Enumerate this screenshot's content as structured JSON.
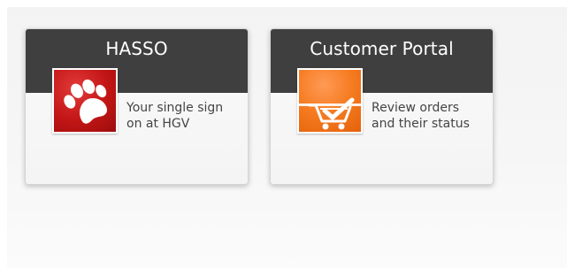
{
  "tiles": [
    {
      "title": "HASSO",
      "description_line1": "Your single sign",
      "description_line2": "on at HGV",
      "icon": "paw-icon",
      "icon_color": "#c21515"
    },
    {
      "title": "Customer Portal",
      "description_line1": "Review orders",
      "description_line2": "and their status",
      "icon": "shopping-cart-icon",
      "icon_color": "#f57a1f"
    }
  ],
  "colors": {
    "header_bg": "#3f3f3f",
    "header_text": "#ffffff",
    "description_text": "#444444"
  }
}
